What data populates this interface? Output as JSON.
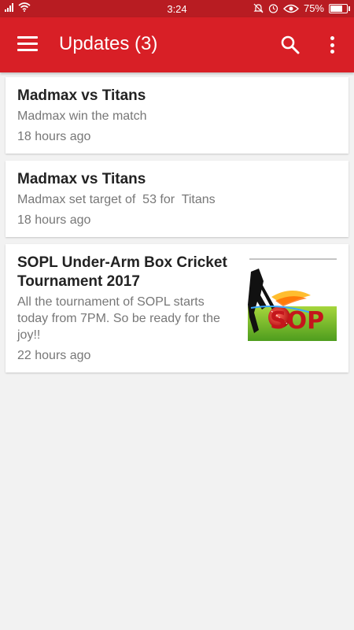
{
  "status_bar": {
    "time": "3:24",
    "battery": "75%",
    "battery_level": 0.75,
    "icons": [
      "signal-icon",
      "wifi-icon",
      "bell-off-icon",
      "alarm-icon",
      "eye-icon",
      "battery-icon"
    ]
  },
  "app_bar": {
    "title": "Updates (3)",
    "color": "#d81f26",
    "icons": [
      "menu-icon",
      "search-icon",
      "more-vert-icon"
    ]
  },
  "updates": [
    {
      "title": "Madmax vs Titans",
      "body": "Madmax win the match",
      "time": "18 hours ago"
    },
    {
      "title": "Madmax vs Titans",
      "body": "Madmax set target of  53 for  Titans",
      "time": "18 hours ago"
    },
    {
      "title": "SOPL Under-Arm Box Cricket Tournament 2017",
      "body": "All the tournament of SOPL starts today from 7PM. So be ready for the joy!!",
      "time": "22 hours ago",
      "image_text": "SOP",
      "image": "cricket-logo-image"
    }
  ]
}
